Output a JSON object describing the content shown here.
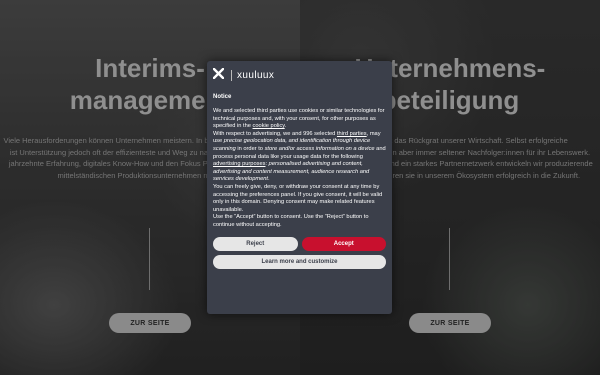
{
  "left": {
    "title_line1": "Interims-",
    "title_line2": "management",
    "description": "Viele Herausforderungen können Unternehmen meistern. In besonders heiklen Situation ist Unterstützung jedoch oft der effizienteste und Weg zu nachhaltigem Erfolg. Durch jahrzehnte Erfahrung, digitales Know-How und den Fokus Problemstellung heben wir mittelständischen Produktionsunternehmen nach vorne.",
    "button_label": "ZUR SEITE"
  },
  "right": {
    "title_line1": "Unternehmens-",
    "title_line2": "beteiligung",
    "description": "Der Mittelstand ist das Rückgrat unserer Wirtschaft. Selbst erfolgreiche Unternehmer:innen finden aber immer seltener Nachfolger:innen für ihr Lebenswerk. Durch Branchenwissen und ein starkes Partnernetzwerk entwickeln wir produzierende Unternehmen und führen sie in unserem Ökosystem erfolgreich in die Zukunft.",
    "button_label": "ZUR SEITE"
  },
  "consent": {
    "brand_name": "xuuluux",
    "heading": "Notice",
    "p1_a": "We and selected third parties use cookies or similar technologies for technical purposes and, with your consent, for other purposes as specified in the ",
    "p1_link": "cookie policy",
    "p1_b": ".",
    "p2_a": "With respect to advertising, we and 996 selected ",
    "p2_link1": "third parties",
    "p2_b": ", may use ",
    "p2_i1": "precise geolocation data, and identification through device scanning",
    "p2_c": " in order to ",
    "p2_i2": "store and/or access information on a device",
    "p2_d": " and process personal data like your usage data for the following ",
    "p2_link2": "advertising purposes",
    "p2_e": ": ",
    "p2_i3": "personalised advertising and content, advertising and content measurement, audience research and services development",
    "p2_f": ".",
    "p3": "You can freely give, deny, or withdraw your consent at any time by accessing the preferences panel. If you give consent, it will be valid only in this domain. Denying consent may make related features unavailable.",
    "p4": "Use the “Accept” button to consent. Use the “Reject” button to continue without accepting.",
    "reject_label": "Reject",
    "accept_label": "Accept",
    "more_label": "Learn more and customize"
  },
  "colors": {
    "accept": "#c8102e",
    "dialog_bg": "#3b3f4a"
  }
}
